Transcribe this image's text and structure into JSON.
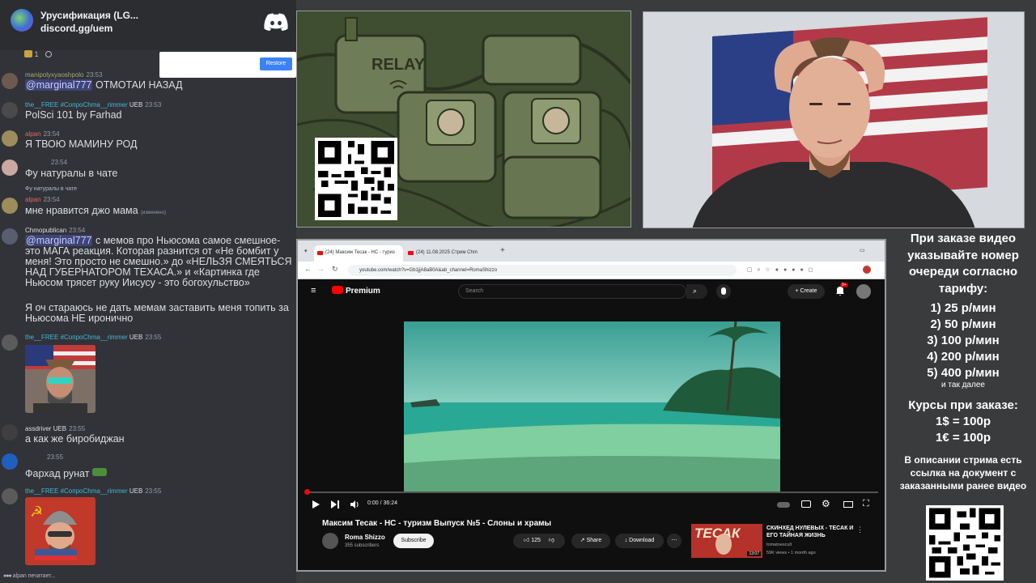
{
  "chat": {
    "server_name": "Урусификация (LG...",
    "server_link": "discord.gg/uem",
    "reaction_count": "1",
    "restore_label": "Restore",
    "messages": [
      {
        "user": "manipolyxyaoshpolo",
        "time": "23:53",
        "text": "ОТМОТАИ НАЗАД",
        "mention": "@marginal777"
      },
      {
        "user": "the__FREE #СопроChma__rimmer",
        "badge": "UEB",
        "time": "23:53",
        "text": "PolSci 101 by Farhad"
      },
      {
        "user": "alpan",
        "time": "23:54",
        "text": "Я ТВОЮ МАМИНУ РОД"
      },
      {
        "user": "",
        "time": "23:54",
        "text": "Фу натуралы в чате"
      },
      {
        "reply": "Фу натуралы в чате",
        "user": "alpan",
        "time": "23:54",
        "text": "мне нравится джо мама",
        "edited": "(изменено)"
      },
      {
        "user": "Chmopublican",
        "time": "23:54",
        "mention": "@marginal777",
        "text": "с мемов про Ньюсома самое смешное- это МАГА реакция. Которая разнится от «Не бомбит у меня! Это просто не смешно.» до «НЕЛЬЗЯ СМЕЯТЬСЯ НАД ГУБЕРНАТОРОМ ТЕХАСА.» и «Картинка где Ньюсом трясет руку Иисусу - это богохульство»",
        "text2": "Я оч стараюсь не дать мемам заставить меня топить за Ньюсома НЕ иронично"
      },
      {
        "user": "the__FREE #СопроChma__rimmer",
        "badge": "UEB",
        "time": "23:55"
      },
      {
        "user": "assdriver",
        "badge": "UEB",
        "time": "23:55",
        "text": "а как же биробиджан"
      },
      {
        "user": "",
        "time": "23:55",
        "text": "Фархад рунат"
      },
      {
        "user": "the__FREE #СопроChma__rimmer",
        "badge": "UEB",
        "time": "23:55"
      }
    ],
    "typing": "alpan печатает..."
  },
  "relay_panel": {
    "label": "RELAY"
  },
  "browser": {
    "tabs": [
      "(24) Максим Тесак - НС - туриз",
      "(24) 11.08.2025 Стрим Chm"
    ],
    "url": "youtube.com/watch?v=Gb1jjA8aB0A&ab_channel=RomaShizzo",
    "youtube_label": "Premium",
    "search_placeholder": "Search",
    "create_label": "Create",
    "notif_count": "9+",
    "timecode": "0:00 / 36:24",
    "progress": 0.0,
    "video_title": "Максим Тесак - НС - туризм Выпуск №5 - Слоны и храмы",
    "channel_name": "Roma Shizzo",
    "channel_subs": "355 subscribers",
    "subscribe_label": "Subscribe",
    "likes": "125",
    "share_label": "Share",
    "download_label": "Download",
    "rec": {
      "title": "СКИНХЕД НУЛЕВЫХ - ТЕСАК И ЕГО ТАЙНАЯ ЖИЗНЬ",
      "channel": "tomatoescult",
      "meta": "59K views • 1 month ago",
      "thumb_text": "ТЕСАК",
      "duration": "13:07"
    }
  },
  "info": {
    "order_text": "При заказе видео указывайте номер очереди согласно тарифу:",
    "rates": [
      "1) 25 р/мин",
      "2) 50 р/мин",
      "3) 100 р/мин",
      "4) 200 р/мин",
      "5) 400 р/мин"
    ],
    "etc": "и так далее",
    "courses_title": "Курсы при заказе:",
    "course_usd": "1$ = 100р",
    "course_eur": "1€ = 100р",
    "desc": "В описании стрима есть ссылка на документ с заказанными ранее видео"
  }
}
